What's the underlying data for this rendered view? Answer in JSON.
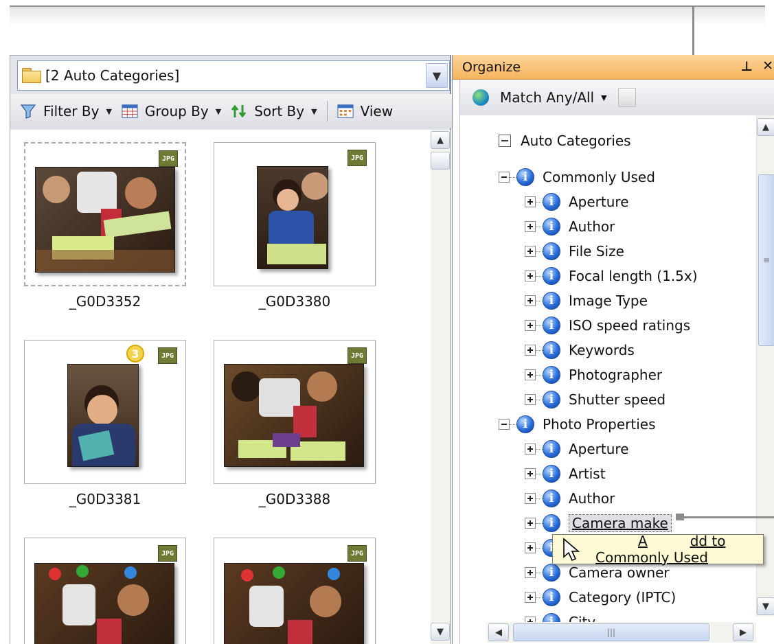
{
  "left_panel": {
    "combo_value": "[2 Auto Categories]",
    "toolbar": {
      "filter_label": "Filter By",
      "group_label": "Group By",
      "sort_label": "Sort By",
      "view_label": "View"
    },
    "thumbnails": [
      {
        "caption": "_G0D3352",
        "badge": "JPG",
        "selected": true
      },
      {
        "caption": "_G0D3380",
        "badge": "JPG"
      },
      {
        "caption": "_G0D3381",
        "badge": "JPG",
        "count": "3"
      },
      {
        "caption": "_G0D3388",
        "badge": "JPG"
      },
      {
        "caption": "",
        "badge": "JPG"
      },
      {
        "caption": "",
        "badge": "JPG"
      }
    ]
  },
  "organize": {
    "title": "Organize",
    "pin": "⊥",
    "close": "✕",
    "match_label": "Match Any/All",
    "root_label": "Auto Categories",
    "tree": [
      {
        "label": "Commonly Used",
        "level": 0,
        "expanded": true
      },
      {
        "label": "Aperture",
        "level": 1
      },
      {
        "label": "Author",
        "level": 1
      },
      {
        "label": "File Size",
        "level": 1
      },
      {
        "label": "Focal length (1.5x)",
        "level": 1
      },
      {
        "label": "Image Type",
        "level": 1
      },
      {
        "label": "ISO speed ratings",
        "level": 1
      },
      {
        "label": "Keywords",
        "level": 1
      },
      {
        "label": "Photographer",
        "level": 1
      },
      {
        "label": "Shutter speed",
        "level": 1
      },
      {
        "label": "Photo Properties",
        "level": 0,
        "expanded": true
      },
      {
        "label": "Aperture",
        "level": 1
      },
      {
        "label": "Artist",
        "level": 1
      },
      {
        "label": "Author",
        "level": 1
      },
      {
        "label": "Camera make",
        "level": 1,
        "highlighted": true
      },
      {
        "label": "",
        "level": 1
      },
      {
        "label": "Camera owner",
        "level": 1
      },
      {
        "label": "Category (IPTC)",
        "level": 1
      },
      {
        "label": "City",
        "level": 1
      }
    ]
  },
  "context_menu": {
    "item_first": "A",
    "item_rest": "dd to Commonly Used"
  },
  "colors": {
    "title_bar": "#f5b45d",
    "info_icon": "#2b6fd9",
    "tooltip_bg": "#fdf9d4"
  }
}
